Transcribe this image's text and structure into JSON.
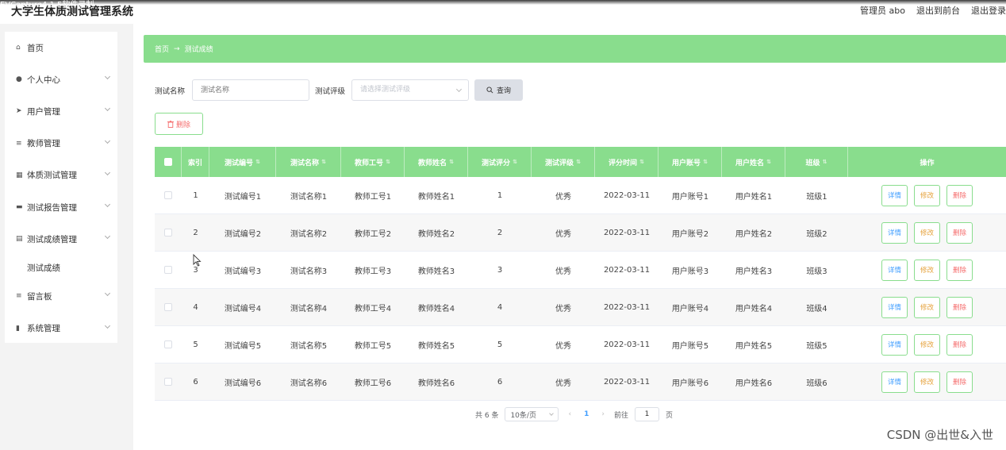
{
  "capture_label": "EVCapture4.1.5软件录制",
  "app_title": "大学生体质测试管理系统",
  "top_links": {
    "admin": "管理员 abo",
    "back_front": "退出到前台",
    "logout": "退出登录"
  },
  "sidebar": {
    "items": [
      {
        "label": "首页",
        "icon": "home-icon"
      },
      {
        "label": "个人中心",
        "icon": "user-icon"
      },
      {
        "label": "用户管理",
        "icon": "send-icon"
      },
      {
        "label": "教师管理",
        "icon": "menu-icon"
      },
      {
        "label": "体质测试管理",
        "icon": "grid-icon"
      },
      {
        "label": "测试报告管理",
        "icon": "report-icon"
      },
      {
        "label": "测试成绩管理",
        "icon": "doc-icon"
      },
      {
        "label": "测试成绩",
        "icon": ""
      },
      {
        "label": "留言板",
        "icon": "menu-icon"
      },
      {
        "label": "系统管理",
        "icon": "chart-icon"
      }
    ]
  },
  "breadcrumb": {
    "home": "首页",
    "sep": "→",
    "current": "测试成绩"
  },
  "filters": {
    "name_label": "测试名称",
    "name_placeholder": "测试名称",
    "grade_label": "测试评级",
    "grade_placeholder": "请选择测试评级",
    "query_label": "查询"
  },
  "delete_label": "删除",
  "table": {
    "headers": [
      "索引",
      "测试编号",
      "测试名称",
      "教师工号",
      "教师姓名",
      "测试评分",
      "测试评级",
      "评分时间",
      "用户账号",
      "用户姓名",
      "班级",
      "操作"
    ],
    "rows": [
      [
        "1",
        "测试编号1",
        "测试名称1",
        "教师工号1",
        "教师姓名1",
        "1",
        "优秀",
        "2022-03-11",
        "用户账号1",
        "用户姓名1",
        "班级1"
      ],
      [
        "2",
        "测试编号2",
        "测试名称2",
        "教师工号2",
        "教师姓名2",
        "2",
        "优秀",
        "2022-03-11",
        "用户账号2",
        "用户姓名2",
        "班级2"
      ],
      [
        "3",
        "测试编号3",
        "测试名称3",
        "教师工号3",
        "教师姓名3",
        "3",
        "优秀",
        "2022-03-11",
        "用户账号3",
        "用户姓名3",
        "班级3"
      ],
      [
        "4",
        "测试编号4",
        "测试名称4",
        "教师工号4",
        "教师姓名4",
        "4",
        "优秀",
        "2022-03-11",
        "用户账号4",
        "用户姓名4",
        "班级4"
      ],
      [
        "5",
        "测试编号5",
        "测试名称5",
        "教师工号5",
        "教师姓名5",
        "5",
        "优秀",
        "2022-03-11",
        "用户账号5",
        "用户姓名5",
        "班级5"
      ],
      [
        "6",
        "测试编号6",
        "测试名称6",
        "教师工号6",
        "教师姓名6",
        "6",
        "优秀",
        "2022-03-11",
        "用户账号6",
        "用户姓名6",
        "班级6"
      ]
    ],
    "actions": {
      "detail": "详情",
      "edit": "修改",
      "remove": "删除"
    }
  },
  "pagination": {
    "total": "共 6 条",
    "page_size": "10条/页",
    "current_page": "1",
    "goto_label": "前往",
    "goto_value": "1",
    "page_suffix": "页"
  },
  "watermark": "CSDN @出世&入世",
  "colors": {
    "accent": "#89dd8d",
    "detail": "#409eff",
    "edit": "#e6a23c",
    "remove": "#f56c6c"
  }
}
